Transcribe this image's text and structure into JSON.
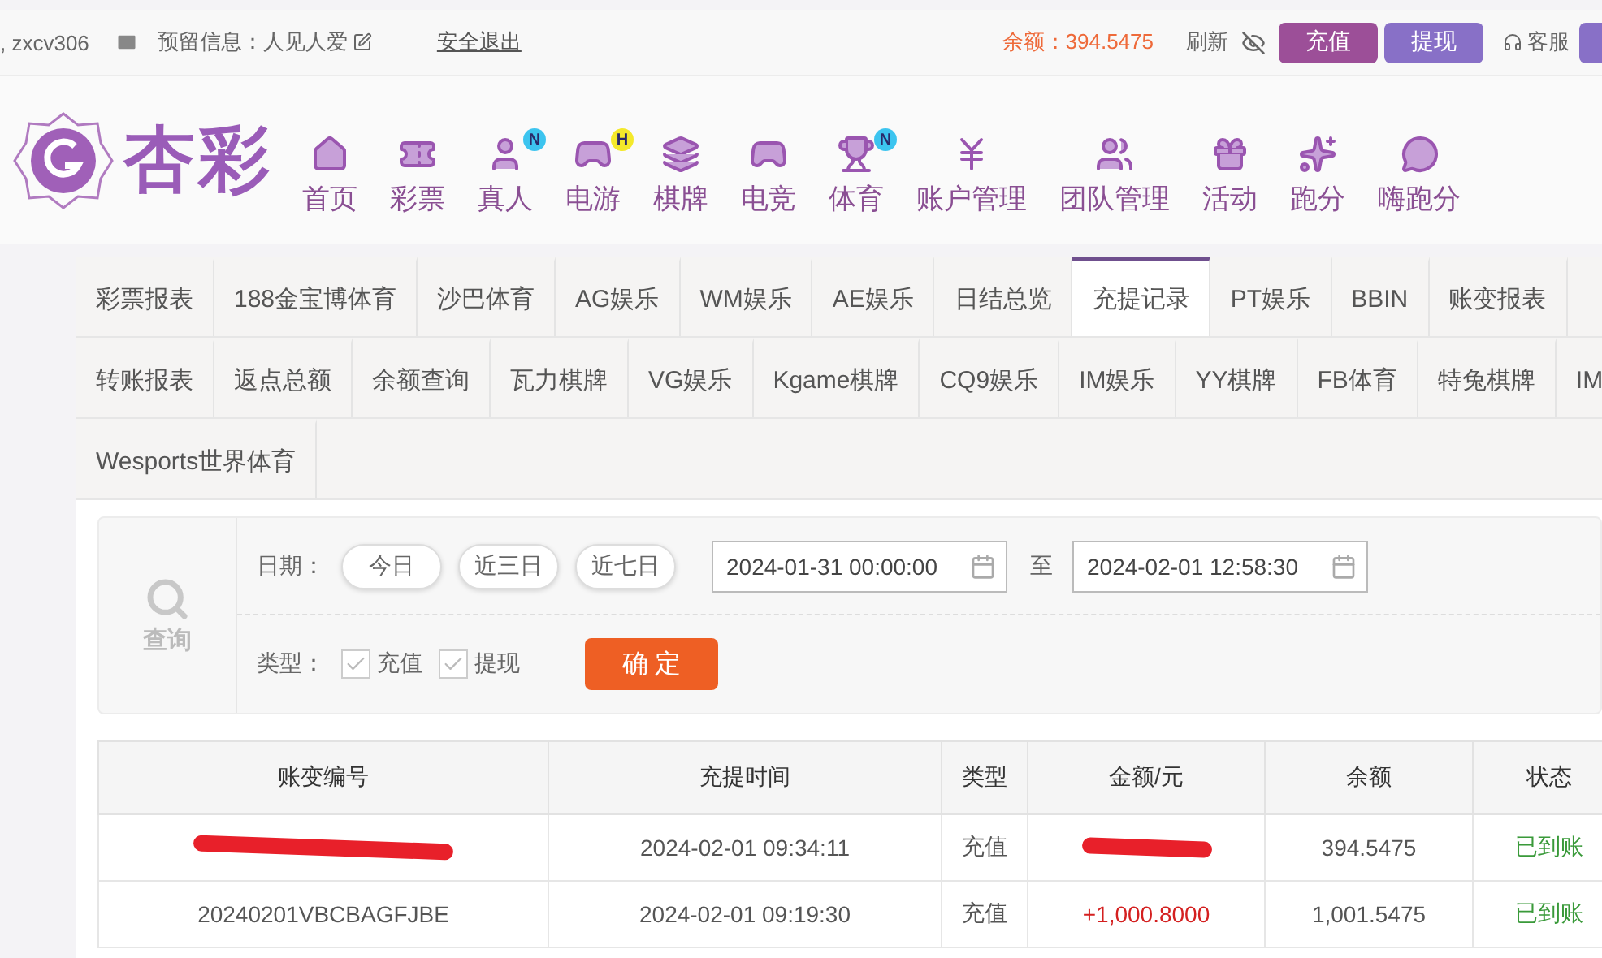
{
  "top_bar": {
    "user": ", zxcv306",
    "reserved_info": "预留信息：人见人爱",
    "logout": "安全退出",
    "balance": "余额：394.5475",
    "refresh": "刷新",
    "buttons": [
      {
        "label": "充值",
        "kind": "deposit"
      },
      {
        "label": "提现",
        "kind": "withdraw"
      }
    ],
    "service": "客服"
  },
  "nav": {
    "items": [
      {
        "label": "首页"
      },
      {
        "label": "彩票"
      },
      {
        "label": "真人",
        "badge": {
          "text": "N",
          "color": "#3cc4ef"
        }
      },
      {
        "label": "电游",
        "badge": {
          "text": "H",
          "color": "#f4e92a"
        }
      },
      {
        "label": "棋牌"
      },
      {
        "label": "电竞"
      },
      {
        "label": "体育",
        "badge": {
          "text": "N",
          "color": "#3cc4ef"
        }
      },
      {
        "label": "账户管理"
      },
      {
        "label": "团队管理"
      },
      {
        "label": "活动"
      },
      {
        "label": "跑分"
      },
      {
        "label": "嗨跑分"
      }
    ]
  },
  "logo": "杏彩",
  "tabs": [
    [
      {
        "label": "彩票报表",
        "selected": false
      },
      {
        "label": "188金宝博体育",
        "selected": false
      },
      {
        "label": "沙巴体育",
        "selected": false
      },
      {
        "label": "AG娱乐",
        "selected": false
      },
      {
        "label": "WM娱乐",
        "selected": false
      },
      {
        "label": "AE娱乐",
        "selected": false
      },
      {
        "label": "日结总览",
        "selected": false
      },
      {
        "label": "充提记录",
        "selected": true
      },
      {
        "label": "PT娱乐",
        "selected": false
      },
      {
        "label": "BBIN",
        "selected": false
      },
      {
        "label": "账变报表",
        "selected": false
      }
    ],
    [
      {
        "label": "转账报表",
        "selected": false
      },
      {
        "label": "返点总额",
        "selected": false
      },
      {
        "label": "余额查询",
        "selected": false
      },
      {
        "label": "瓦力棋牌",
        "selected": false
      },
      {
        "label": "VG娱乐",
        "selected": false
      },
      {
        "label": "Kgame棋牌",
        "selected": false
      },
      {
        "label": "CQ9娱乐",
        "selected": false
      },
      {
        "label": "IM娱乐",
        "selected": false
      },
      {
        "label": "YY棋牌",
        "selected": false
      },
      {
        "label": "FB体育",
        "selected": false
      },
      {
        "label": "特兔棋牌",
        "selected": false
      },
      {
        "label": "IM",
        "selected": false
      }
    ],
    [
      {
        "label": "Wesports世界体育",
        "selected": false
      }
    ]
  ],
  "filter": {
    "search_label": "查询",
    "date_label": "日期：",
    "quick_dates": [
      "今日",
      "近三日",
      "近七日"
    ],
    "start": "2024-01-31 00:00:00",
    "to": "至",
    "end": "2024-02-01 12:58:30",
    "type_label": "类型：",
    "types": [
      {
        "label": "充值",
        "checked": true
      },
      {
        "label": "提现",
        "checked": true
      }
    ],
    "confirm": "确 定"
  },
  "table": {
    "columns": [
      "账变编号",
      "充提时间",
      "类型",
      "金额/元",
      "余额",
      "状态"
    ],
    "rows": [
      {
        "redacted": true,
        "time": "2024-02-01 09:34:11",
        "type": "充值",
        "balance": "394.5475",
        "status": "已到账"
      },
      {
        "redacted": false,
        "id": "20240201VBCBAGFJBE",
        "time": "2024-02-01 09:19:30",
        "type": "充值",
        "amount": "+1,000.8000",
        "balance": "1,001.5475",
        "status": "已到账"
      }
    ]
  }
}
